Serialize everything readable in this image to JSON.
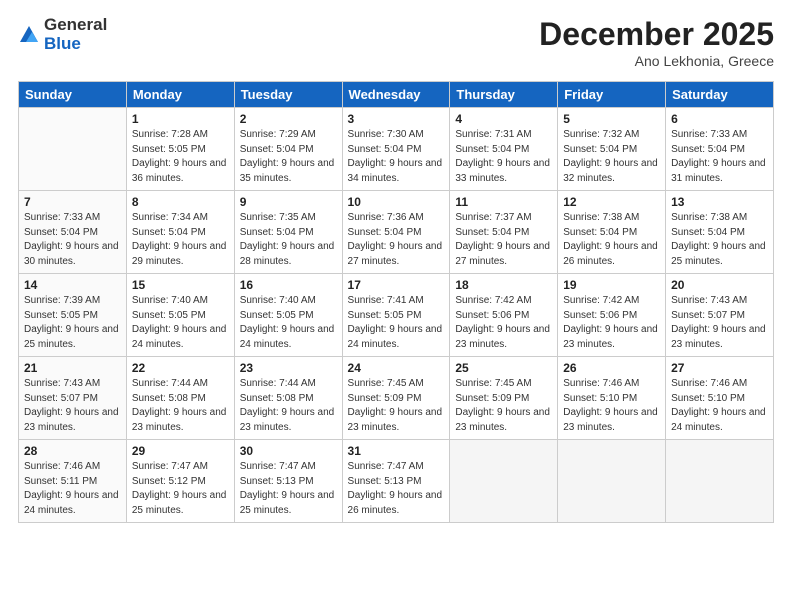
{
  "logo": {
    "general": "General",
    "blue": "Blue"
  },
  "header": {
    "month": "December 2025",
    "location": "Ano Lekhonia, Greece"
  },
  "days_of_week": [
    "Sunday",
    "Monday",
    "Tuesday",
    "Wednesday",
    "Thursday",
    "Friday",
    "Saturday"
  ],
  "weeks": [
    [
      {
        "num": "",
        "sunrise": "",
        "sunset": "",
        "daylight": "",
        "empty": true
      },
      {
        "num": "1",
        "sunrise": "Sunrise: 7:28 AM",
        "sunset": "Sunset: 5:05 PM",
        "daylight": "Daylight: 9 hours and 36 minutes."
      },
      {
        "num": "2",
        "sunrise": "Sunrise: 7:29 AM",
        "sunset": "Sunset: 5:04 PM",
        "daylight": "Daylight: 9 hours and 35 minutes."
      },
      {
        "num": "3",
        "sunrise": "Sunrise: 7:30 AM",
        "sunset": "Sunset: 5:04 PM",
        "daylight": "Daylight: 9 hours and 34 minutes."
      },
      {
        "num": "4",
        "sunrise": "Sunrise: 7:31 AM",
        "sunset": "Sunset: 5:04 PM",
        "daylight": "Daylight: 9 hours and 33 minutes."
      },
      {
        "num": "5",
        "sunrise": "Sunrise: 7:32 AM",
        "sunset": "Sunset: 5:04 PM",
        "daylight": "Daylight: 9 hours and 32 minutes."
      },
      {
        "num": "6",
        "sunrise": "Sunrise: 7:33 AM",
        "sunset": "Sunset: 5:04 PM",
        "daylight": "Daylight: 9 hours and 31 minutes."
      }
    ],
    [
      {
        "num": "7",
        "sunrise": "Sunrise: 7:33 AM",
        "sunset": "Sunset: 5:04 PM",
        "daylight": "Daylight: 9 hours and 30 minutes."
      },
      {
        "num": "8",
        "sunrise": "Sunrise: 7:34 AM",
        "sunset": "Sunset: 5:04 PM",
        "daylight": "Daylight: 9 hours and 29 minutes."
      },
      {
        "num": "9",
        "sunrise": "Sunrise: 7:35 AM",
        "sunset": "Sunset: 5:04 PM",
        "daylight": "Daylight: 9 hours and 28 minutes."
      },
      {
        "num": "10",
        "sunrise": "Sunrise: 7:36 AM",
        "sunset": "Sunset: 5:04 PM",
        "daylight": "Daylight: 9 hours and 27 minutes."
      },
      {
        "num": "11",
        "sunrise": "Sunrise: 7:37 AM",
        "sunset": "Sunset: 5:04 PM",
        "daylight": "Daylight: 9 hours and 27 minutes."
      },
      {
        "num": "12",
        "sunrise": "Sunrise: 7:38 AM",
        "sunset": "Sunset: 5:04 PM",
        "daylight": "Daylight: 9 hours and 26 minutes."
      },
      {
        "num": "13",
        "sunrise": "Sunrise: 7:38 AM",
        "sunset": "Sunset: 5:04 PM",
        "daylight": "Daylight: 9 hours and 25 minutes."
      }
    ],
    [
      {
        "num": "14",
        "sunrise": "Sunrise: 7:39 AM",
        "sunset": "Sunset: 5:05 PM",
        "daylight": "Daylight: 9 hours and 25 minutes."
      },
      {
        "num": "15",
        "sunrise": "Sunrise: 7:40 AM",
        "sunset": "Sunset: 5:05 PM",
        "daylight": "Daylight: 9 hours and 24 minutes."
      },
      {
        "num": "16",
        "sunrise": "Sunrise: 7:40 AM",
        "sunset": "Sunset: 5:05 PM",
        "daylight": "Daylight: 9 hours and 24 minutes."
      },
      {
        "num": "17",
        "sunrise": "Sunrise: 7:41 AM",
        "sunset": "Sunset: 5:05 PM",
        "daylight": "Daylight: 9 hours and 24 minutes."
      },
      {
        "num": "18",
        "sunrise": "Sunrise: 7:42 AM",
        "sunset": "Sunset: 5:06 PM",
        "daylight": "Daylight: 9 hours and 23 minutes."
      },
      {
        "num": "19",
        "sunrise": "Sunrise: 7:42 AM",
        "sunset": "Sunset: 5:06 PM",
        "daylight": "Daylight: 9 hours and 23 minutes."
      },
      {
        "num": "20",
        "sunrise": "Sunrise: 7:43 AM",
        "sunset": "Sunset: 5:07 PM",
        "daylight": "Daylight: 9 hours and 23 minutes."
      }
    ],
    [
      {
        "num": "21",
        "sunrise": "Sunrise: 7:43 AM",
        "sunset": "Sunset: 5:07 PM",
        "daylight": "Daylight: 9 hours and 23 minutes."
      },
      {
        "num": "22",
        "sunrise": "Sunrise: 7:44 AM",
        "sunset": "Sunset: 5:08 PM",
        "daylight": "Daylight: 9 hours and 23 minutes."
      },
      {
        "num": "23",
        "sunrise": "Sunrise: 7:44 AM",
        "sunset": "Sunset: 5:08 PM",
        "daylight": "Daylight: 9 hours and 23 minutes."
      },
      {
        "num": "24",
        "sunrise": "Sunrise: 7:45 AM",
        "sunset": "Sunset: 5:09 PM",
        "daylight": "Daylight: 9 hours and 23 minutes."
      },
      {
        "num": "25",
        "sunrise": "Sunrise: 7:45 AM",
        "sunset": "Sunset: 5:09 PM",
        "daylight": "Daylight: 9 hours and 23 minutes."
      },
      {
        "num": "26",
        "sunrise": "Sunrise: 7:46 AM",
        "sunset": "Sunset: 5:10 PM",
        "daylight": "Daylight: 9 hours and 23 minutes."
      },
      {
        "num": "27",
        "sunrise": "Sunrise: 7:46 AM",
        "sunset": "Sunset: 5:10 PM",
        "daylight": "Daylight: 9 hours and 24 minutes."
      }
    ],
    [
      {
        "num": "28",
        "sunrise": "Sunrise: 7:46 AM",
        "sunset": "Sunset: 5:11 PM",
        "daylight": "Daylight: 9 hours and 24 minutes."
      },
      {
        "num": "29",
        "sunrise": "Sunrise: 7:47 AM",
        "sunset": "Sunset: 5:12 PM",
        "daylight": "Daylight: 9 hours and 25 minutes."
      },
      {
        "num": "30",
        "sunrise": "Sunrise: 7:47 AM",
        "sunset": "Sunset: 5:13 PM",
        "daylight": "Daylight: 9 hours and 25 minutes."
      },
      {
        "num": "31",
        "sunrise": "Sunrise: 7:47 AM",
        "sunset": "Sunset: 5:13 PM",
        "daylight": "Daylight: 9 hours and 26 minutes."
      },
      {
        "num": "",
        "sunrise": "",
        "sunset": "",
        "daylight": "",
        "empty": true
      },
      {
        "num": "",
        "sunrise": "",
        "sunset": "",
        "daylight": "",
        "empty": true
      },
      {
        "num": "",
        "sunrise": "",
        "sunset": "",
        "daylight": "",
        "empty": true
      }
    ]
  ]
}
